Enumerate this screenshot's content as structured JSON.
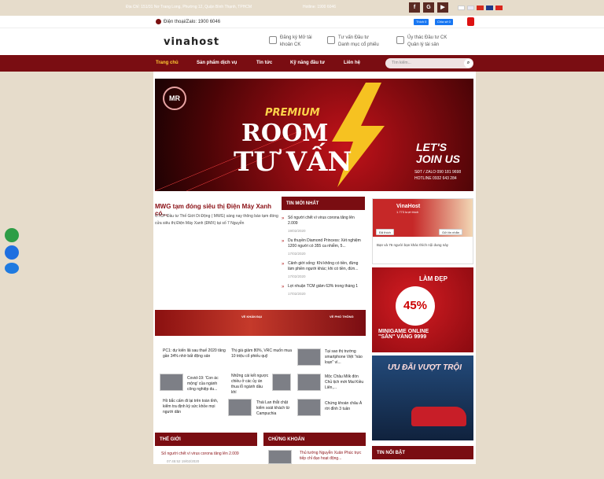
{
  "topbar": {
    "address": "Địa Chỉ: 151/31 Nơ Trang Long, Phường 12, Quận Bình Thạnh, TPHCM",
    "hotline": "Hotline: 1900 6046"
  },
  "header": {
    "phone": "Điện thoại/Zalo: 1900 6046",
    "fb_like": "Thích 0",
    "fb_share": "Chia sẻ 0",
    "logo": "vinahost",
    "links": [
      {
        "l1": "Đăng ký Mở tài",
        "l2": "khoản CK"
      },
      {
        "l1": "Tư vấn Đầu tư",
        "l2": "Danh mục cổ phiếu"
      },
      {
        "l1": "Ủy thác Đầu tư CK",
        "l2": "Quản lý tài sản"
      }
    ]
  },
  "nav": {
    "items": [
      "Trang chủ",
      "Sản phẩm dịch vụ",
      "Tin tức",
      "Kỹ năng đầu tư",
      "Liên hệ"
    ],
    "search_placeholder": "Tìm kiếm..."
  },
  "banner": {
    "badge": "MR",
    "premium": "PREMIUM",
    "room": "ROOM",
    "tuvan": "TƯ VẤN",
    "join1": "LET'S",
    "join2": "JOIN US",
    "contact1": "SĐT / ZALO   090 181 9698",
    "contact2": "HOTLINE    0932 643 284"
  },
  "story": {
    "title": "MWG tạm đóng siêu thị Điện Máy Xanh có...",
    "desc": "CTCP Đầu tư Thế Giới Di Động ( MWG) sáng nay thông báo tạm đóng cửa siêu thị Điện Máy Xanh (ĐMX) tại số 7 Nguyễn"
  },
  "latest": {
    "heading": "TIN MỚI NHẤT",
    "items": [
      {
        "t": "Số người chết vì virus corona tăng lên 2.009",
        "d": "19/02/2020"
      },
      {
        "t": "Du thuyền Diamond Princess: Xét nghiệm 1200 người có 355 ca nhiễm, 5...",
        "d": "17/02/2020"
      },
      {
        "t": "Cảnh giới sống: Khi không có tiền, đừng làm phiền người khác; khi có tiền, đừn...",
        "d": "17/02/2020"
      },
      {
        "t": "Lợi nhuận TCM giảm 63% trong tháng 1",
        "d": "17/02/2020"
      }
    ]
  },
  "fbbox": {
    "name": "VinaHost",
    "likes": "1.773 lượt thích",
    "friends": "Bạn và 76 người bạn khác thích nội dung này",
    "send": "Gửi tin nhắn",
    "liked": "Đã thích"
  },
  "ads": {
    "promo1": "LÀM ĐẸP",
    "percent": "45%",
    "minigame": "MINIGAME ONLINE",
    "vang": "\"SĂN\" VÀNG 9999",
    "promo2": "ƯU ĐÃI VƯỢT TRỘI"
  },
  "stripe": {
    "a": "VỀ KHÁN ĐẠI",
    "b": "VỀ PHỐ THÔNG"
  },
  "grid": [
    "PC1: dự kiến lãi sau thuế 2020 tăng gần 34% nhờ bất động sản",
    "Thị giá giảm 80%, VRC muốn mua 10 triệu cổ phiếu quỹ",
    "Tại sao thị trường smartphone Việt \"nào loạn\" vì...",
    "Covid-19: 'Con ác mộng' của ngành công nghiệp du...",
    "Những cái kết ngược chiều ở các ủy án thua lỗ ngành dầu khí",
    "Mộc Châu Milk đón Chủ tịch mới Mai Kiều Liên,...",
    "Hồ bắc cấm đi lại trên toàn tỉnh, kiểm tra định kỳ sức khỏe mọi người dân",
    "Thái Lan thắt chặt kiểm soát khách từ Campuchia",
    "Chứng khoán châu Á rời đỉnh 3 tuần"
  ],
  "sections": {
    "world": "THẾ GIỚI",
    "world_item": "Số người chết vì virus corona tăng lên 2.009",
    "world_date": "07:45:52 19/02/2020",
    "stock": "CHỨNG KHOÁN",
    "stock_item": "Thủ tướng Nguyễn Xuân Phúc trực tiếp chỉ đạo hoạt động...",
    "featured": "TIN NỔI BẬT"
  },
  "colors": {
    "brand": "#7a0d12",
    "accent": "#b01818",
    "bg": "#e6dccb"
  }
}
